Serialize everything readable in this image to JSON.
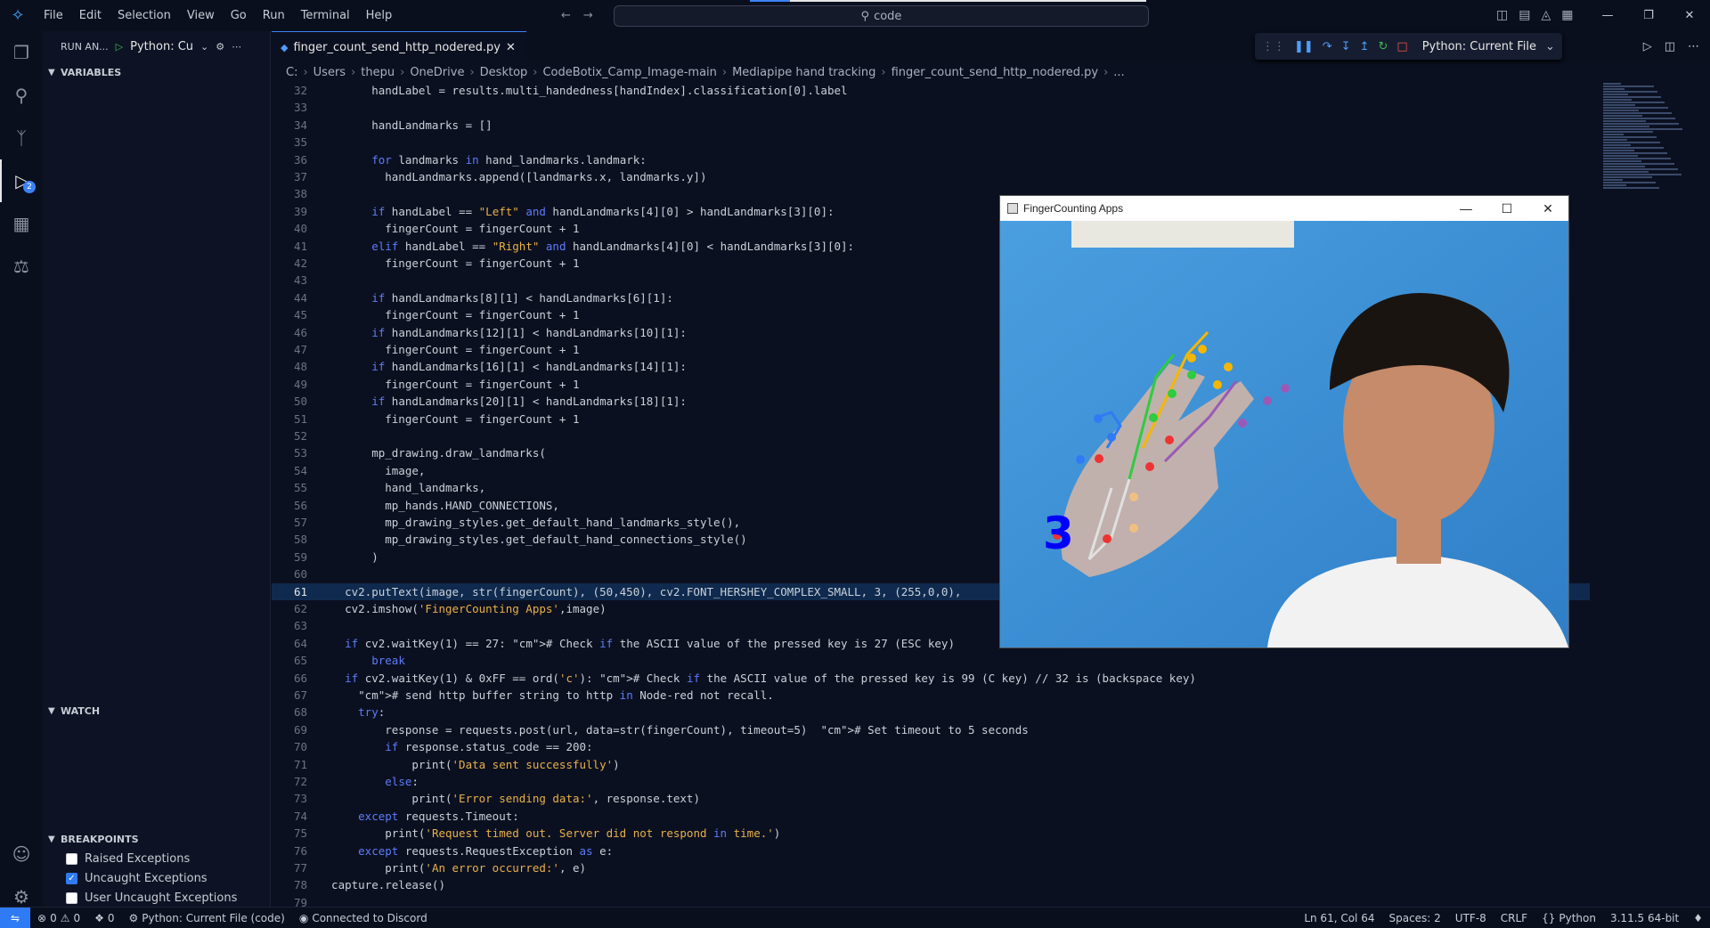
{
  "titlebar": {
    "menu": [
      "File",
      "Edit",
      "Selection",
      "View",
      "Go",
      "Run",
      "Terminal",
      "Help"
    ],
    "search_text": "code"
  },
  "sidebar": {
    "header_title": "RUN AN...",
    "config_name": "Python: Cu",
    "sections": {
      "variables": "VARIABLES",
      "watch": "WATCH",
      "breakpoints": "BREAKPOINTS"
    },
    "breakpoints": [
      {
        "label": "Raised Exceptions",
        "checked": false
      },
      {
        "label": "Uncaught Exceptions",
        "checked": true
      },
      {
        "label": "User Uncaught Exceptions",
        "checked": false
      }
    ]
  },
  "activity_badge": "2",
  "tab": {
    "filename": "finger_count_send_http_nodered.py",
    "icon": "python-icon"
  },
  "debug_toolbar": {
    "config_name": "Python: Current File"
  },
  "breadcrumb": [
    "C:",
    "Users",
    "thepu",
    "OneDrive",
    "Desktop",
    "CodeBotix_Camp_Image-main",
    "Mediapipe hand tracking",
    "finger_count_send_http_nodered.py",
    "..."
  ],
  "editor": {
    "current_line": 61,
    "lines": [
      {
        "n": "32",
        "t": "        handLabel = results.multi_handedness[handIndex].classification[0].label"
      },
      {
        "n": "33",
        "t": ""
      },
      {
        "n": "34",
        "t": "        handLandmarks = []"
      },
      {
        "n": "35",
        "t": ""
      },
      {
        "n": "36",
        "t": "        for landmarks in hand_landmarks.landmark:"
      },
      {
        "n": "37",
        "t": "          handLandmarks.append([landmarks.x, landmarks.y])"
      },
      {
        "n": "38",
        "t": ""
      },
      {
        "n": "39",
        "t": "        if handLabel == \"Left\" and handLandmarks[4][0] > handLandmarks[3][0]:"
      },
      {
        "n": "40",
        "t": "          fingerCount = fingerCount + 1"
      },
      {
        "n": "41",
        "t": "        elif handLabel == \"Right\" and handLandmarks[4][0] < handLandmarks[3][0]:"
      },
      {
        "n": "42",
        "t": "          fingerCount = fingerCount + 1"
      },
      {
        "n": "43",
        "t": ""
      },
      {
        "n": "44",
        "t": "        if handLandmarks[8][1] < handLandmarks[6][1]:"
      },
      {
        "n": "45",
        "t": "          fingerCount = fingerCount + 1"
      },
      {
        "n": "46",
        "t": "        if handLandmarks[12][1] < handLandmarks[10][1]:"
      },
      {
        "n": "47",
        "t": "          fingerCount = fingerCount + 1"
      },
      {
        "n": "48",
        "t": "        if handLandmarks[16][1] < handLandmarks[14][1]:"
      },
      {
        "n": "49",
        "t": "          fingerCount = fingerCount + 1"
      },
      {
        "n": "50",
        "t": "        if handLandmarks[20][1] < handLandmarks[18][1]:"
      },
      {
        "n": "51",
        "t": "          fingerCount = fingerCount + 1"
      },
      {
        "n": "52",
        "t": ""
      },
      {
        "n": "53",
        "t": "        mp_drawing.draw_landmarks("
      },
      {
        "n": "54",
        "t": "          image,"
      },
      {
        "n": "55",
        "t": "          hand_landmarks,"
      },
      {
        "n": "56",
        "t": "          mp_hands.HAND_CONNECTIONS,"
      },
      {
        "n": "57",
        "t": "          mp_drawing_styles.get_default_hand_landmarks_style(),"
      },
      {
        "n": "58",
        "t": "          mp_drawing_styles.get_default_hand_connections_style()"
      },
      {
        "n": "59",
        "t": "        )"
      },
      {
        "n": "60",
        "t": ""
      },
      {
        "n": "61",
        "t": "    cv2.putText(image, str(fingerCount), (50,450), cv2.FONT_HERSHEY_COMPLEX_SMALL, 3, (255,0,0), "
      },
      {
        "n": "62",
        "t": "    cv2.imshow('FingerCounting Apps',image)"
      },
      {
        "n": "63",
        "t": ""
      },
      {
        "n": "64",
        "t": "    if cv2.waitKey(1) == 27: # Check if the ASCII value of the pressed key is 27 (ESC key)"
      },
      {
        "n": "65",
        "t": "        break"
      },
      {
        "n": "66",
        "t": "    if cv2.waitKey(1) & 0xFF == ord('c'): # Check if the ASCII value of the pressed key is 99 (C key) // 32 is (backspace key)"
      },
      {
        "n": "67",
        "t": "      # send http buffer string to http in Node-red not recall."
      },
      {
        "n": "68",
        "t": "      try:"
      },
      {
        "n": "69",
        "t": "          response = requests.post(url, data=str(fingerCount), timeout=5)  # Set timeout to 5 seconds"
      },
      {
        "n": "70",
        "t": "          if response.status_code == 200:"
      },
      {
        "n": "71",
        "t": "              print('Data sent successfully')"
      },
      {
        "n": "72",
        "t": "          else:"
      },
      {
        "n": "73",
        "t": "              print('Error sending data:', response.text)"
      },
      {
        "n": "74",
        "t": "      except requests.Timeout:"
      },
      {
        "n": "75",
        "t": "          print('Request timed out. Server did not respond in time.')"
      },
      {
        "n": "76",
        "t": "      except requests.RequestException as e:"
      },
      {
        "n": "77",
        "t": "          print('An error occurred:', e)"
      },
      {
        "n": "78",
        "t": "  capture.release()"
      },
      {
        "n": "79",
        "t": ""
      }
    ]
  },
  "app_window": {
    "title": "FingerCounting Apps",
    "overlay_count": "3"
  },
  "statusbar": {
    "errors": "0",
    "warnings": "0",
    "ports": "0",
    "run_config": "Python: Current File (code)",
    "discord": "Connected to Discord",
    "position": "Ln 61, Col 64",
    "spaces": "Spaces: 2",
    "encoding": "UTF-8",
    "eol": "CRLF",
    "language": "Python",
    "interpreter": "3.11.5 64-bit"
  },
  "colors": {
    "accent": "#2f7bf5",
    "bg": "#0b1020"
  }
}
